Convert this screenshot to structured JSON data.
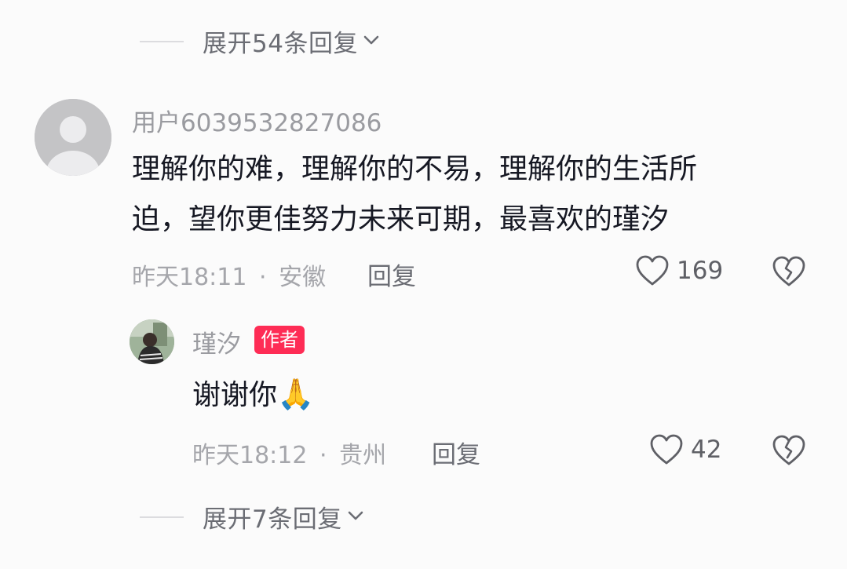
{
  "top_expand": {
    "label": "展开54条回复"
  },
  "comment": {
    "username": "用户6039532827086",
    "text_line1": "理解你的难，理解你的不易，理解你的生活所",
    "text_line2": "迫，望你更佳努力未来可期，最喜欢的瑾汐",
    "time": "昨天18:11",
    "separator": "·",
    "location": "安徽",
    "reply_label": "回复",
    "like_count": "169"
  },
  "reply": {
    "username": "瑾汐",
    "badge": "作者",
    "text": "谢谢你",
    "emoji": "🙏",
    "time": "昨天18:12",
    "separator": "·",
    "location": "贵州",
    "reply_label": "回复",
    "like_count": "42"
  },
  "bottom_expand": {
    "label": "展开7条回复"
  },
  "colors": {
    "badge": "#fe2c55",
    "background": "#fbfbfb",
    "text_primary": "#161823",
    "text_secondary": "#a5a6ab"
  },
  "icons": {
    "chevron": "chevron-down-icon",
    "like": "heart-outline-icon",
    "dislike": "broken-heart-icon",
    "avatar_placeholder": "default-user-icon"
  }
}
